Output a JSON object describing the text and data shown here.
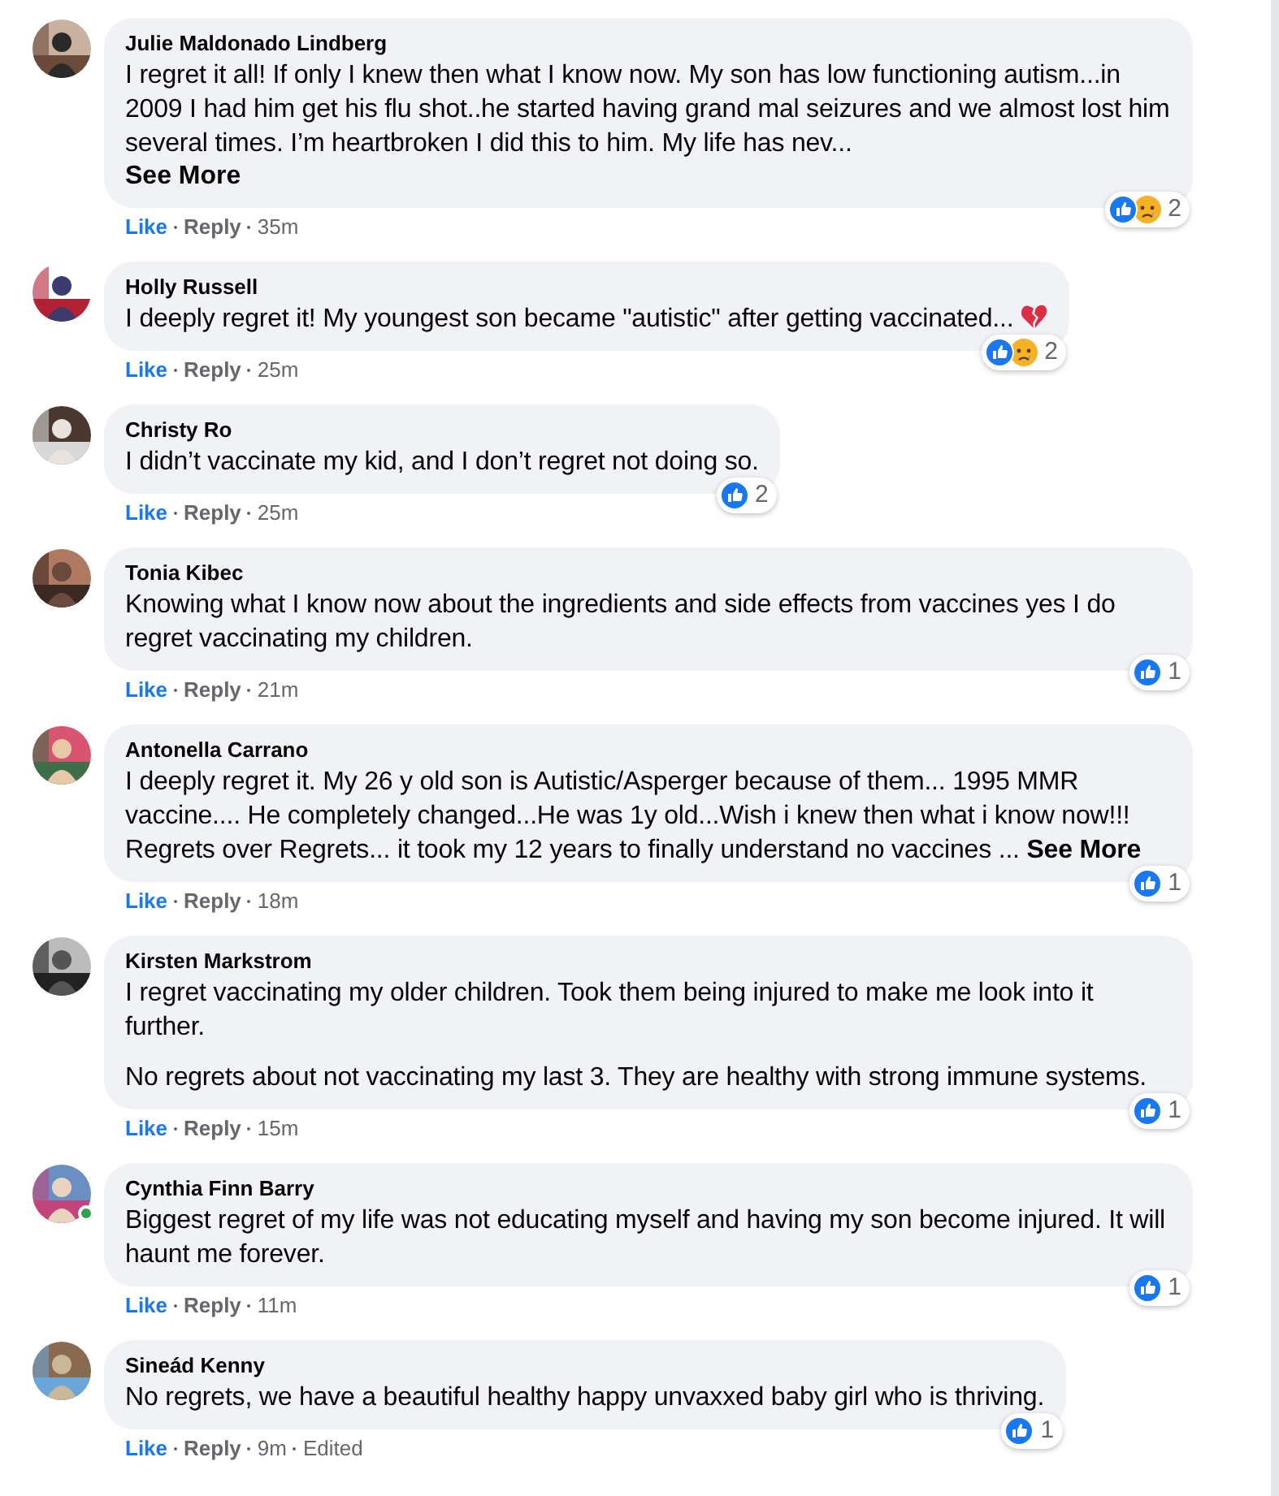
{
  "comments": [
    {
      "author": "Julie Maldonado Lindberg",
      "paragraphs": [
        "I regret it all! If only I knew then what I know now. My son has low functioning autism...in 2009 I had him get his flu shot..he started having grand mal seizures and we almost lost him several times. I’m heartbroken I did this to him. My life has nev..."
      ],
      "see_more": "See More",
      "see_more_inline": false,
      "broken_heart": false,
      "online": false,
      "reactions": [
        {
          "kind": "like"
        },
        {
          "kind": "sad"
        }
      ],
      "reaction_count": "2",
      "actions": [
        "Like",
        "Reply"
      ],
      "time": "35m"
    },
    {
      "author": "Holly Russell",
      "paragraphs": [
        "I deeply regret it! My youngest son became \"autistic\" after getting vaccinated..."
      ],
      "broken_heart": true,
      "online": false,
      "reactions": [
        {
          "kind": "like"
        },
        {
          "kind": "sad"
        }
      ],
      "reaction_count": "2",
      "actions": [
        "Like",
        "Reply"
      ],
      "time": "25m"
    },
    {
      "author": "Christy Ro",
      "paragraphs": [
        "I didn’t vaccinate my kid, and I don’t regret not doing so."
      ],
      "broken_heart": false,
      "online": false,
      "reactions": [
        {
          "kind": "like"
        }
      ],
      "reaction_count": "2",
      "actions": [
        "Like",
        "Reply"
      ],
      "time": "25m"
    },
    {
      "author": "Tonia Kibec",
      "paragraphs": [
        "Knowing what I know now about the ingredients and side effects from vaccines yes I do regret vaccinating my children."
      ],
      "broken_heart": false,
      "online": false,
      "reactions": [
        {
          "kind": "like"
        }
      ],
      "reaction_count": "1",
      "actions": [
        "Like",
        "Reply"
      ],
      "time": "21m"
    },
    {
      "author": "Antonella Carrano",
      "paragraphs": [
        "I deeply regret it. My 26 y old son is Autistic/Asperger because of them... 1995 MMR vaccine.... He completely changed...He was 1y old...Wish i knew then what i know now!!! Regrets over Regrets... it took my 12 years to finally understand no vaccines ..."
      ],
      "see_more": "See More",
      "see_more_inline": true,
      "broken_heart": false,
      "online": false,
      "reactions": [
        {
          "kind": "like"
        }
      ],
      "reaction_count": "1",
      "actions": [
        "Like",
        "Reply"
      ],
      "time": "18m"
    },
    {
      "author": "Kirsten Markstrom",
      "paragraphs": [
        "I regret vaccinating my older children. Took them being injured to make me look into it further.",
        "No regrets about not vaccinating my last 3. They are healthy with strong immune systems."
      ],
      "broken_heart": false,
      "online": false,
      "reactions": [
        {
          "kind": "like"
        }
      ],
      "reaction_count": "1",
      "actions": [
        "Like",
        "Reply"
      ],
      "time": "15m"
    },
    {
      "author": "Cynthia Finn Barry",
      "paragraphs": [
        "Biggest regret of my life was not educating myself and having my son become injured. It will haunt me forever."
      ],
      "broken_heart": false,
      "online": true,
      "reactions": [
        {
          "kind": "like"
        }
      ],
      "reaction_count": "1",
      "actions": [
        "Like",
        "Reply"
      ],
      "time": "11m"
    },
    {
      "author": "Sineád Kenny",
      "paragraphs": [
        "No regrets, we have a beautiful healthy happy unvaxxed baby girl who is thriving."
      ],
      "broken_heart": false,
      "online": false,
      "reactions": [
        {
          "kind": "like"
        }
      ],
      "reaction_count": "1",
      "actions": [
        "Like",
        "Reply"
      ],
      "time": "9m",
      "edited": "Edited"
    }
  ]
}
